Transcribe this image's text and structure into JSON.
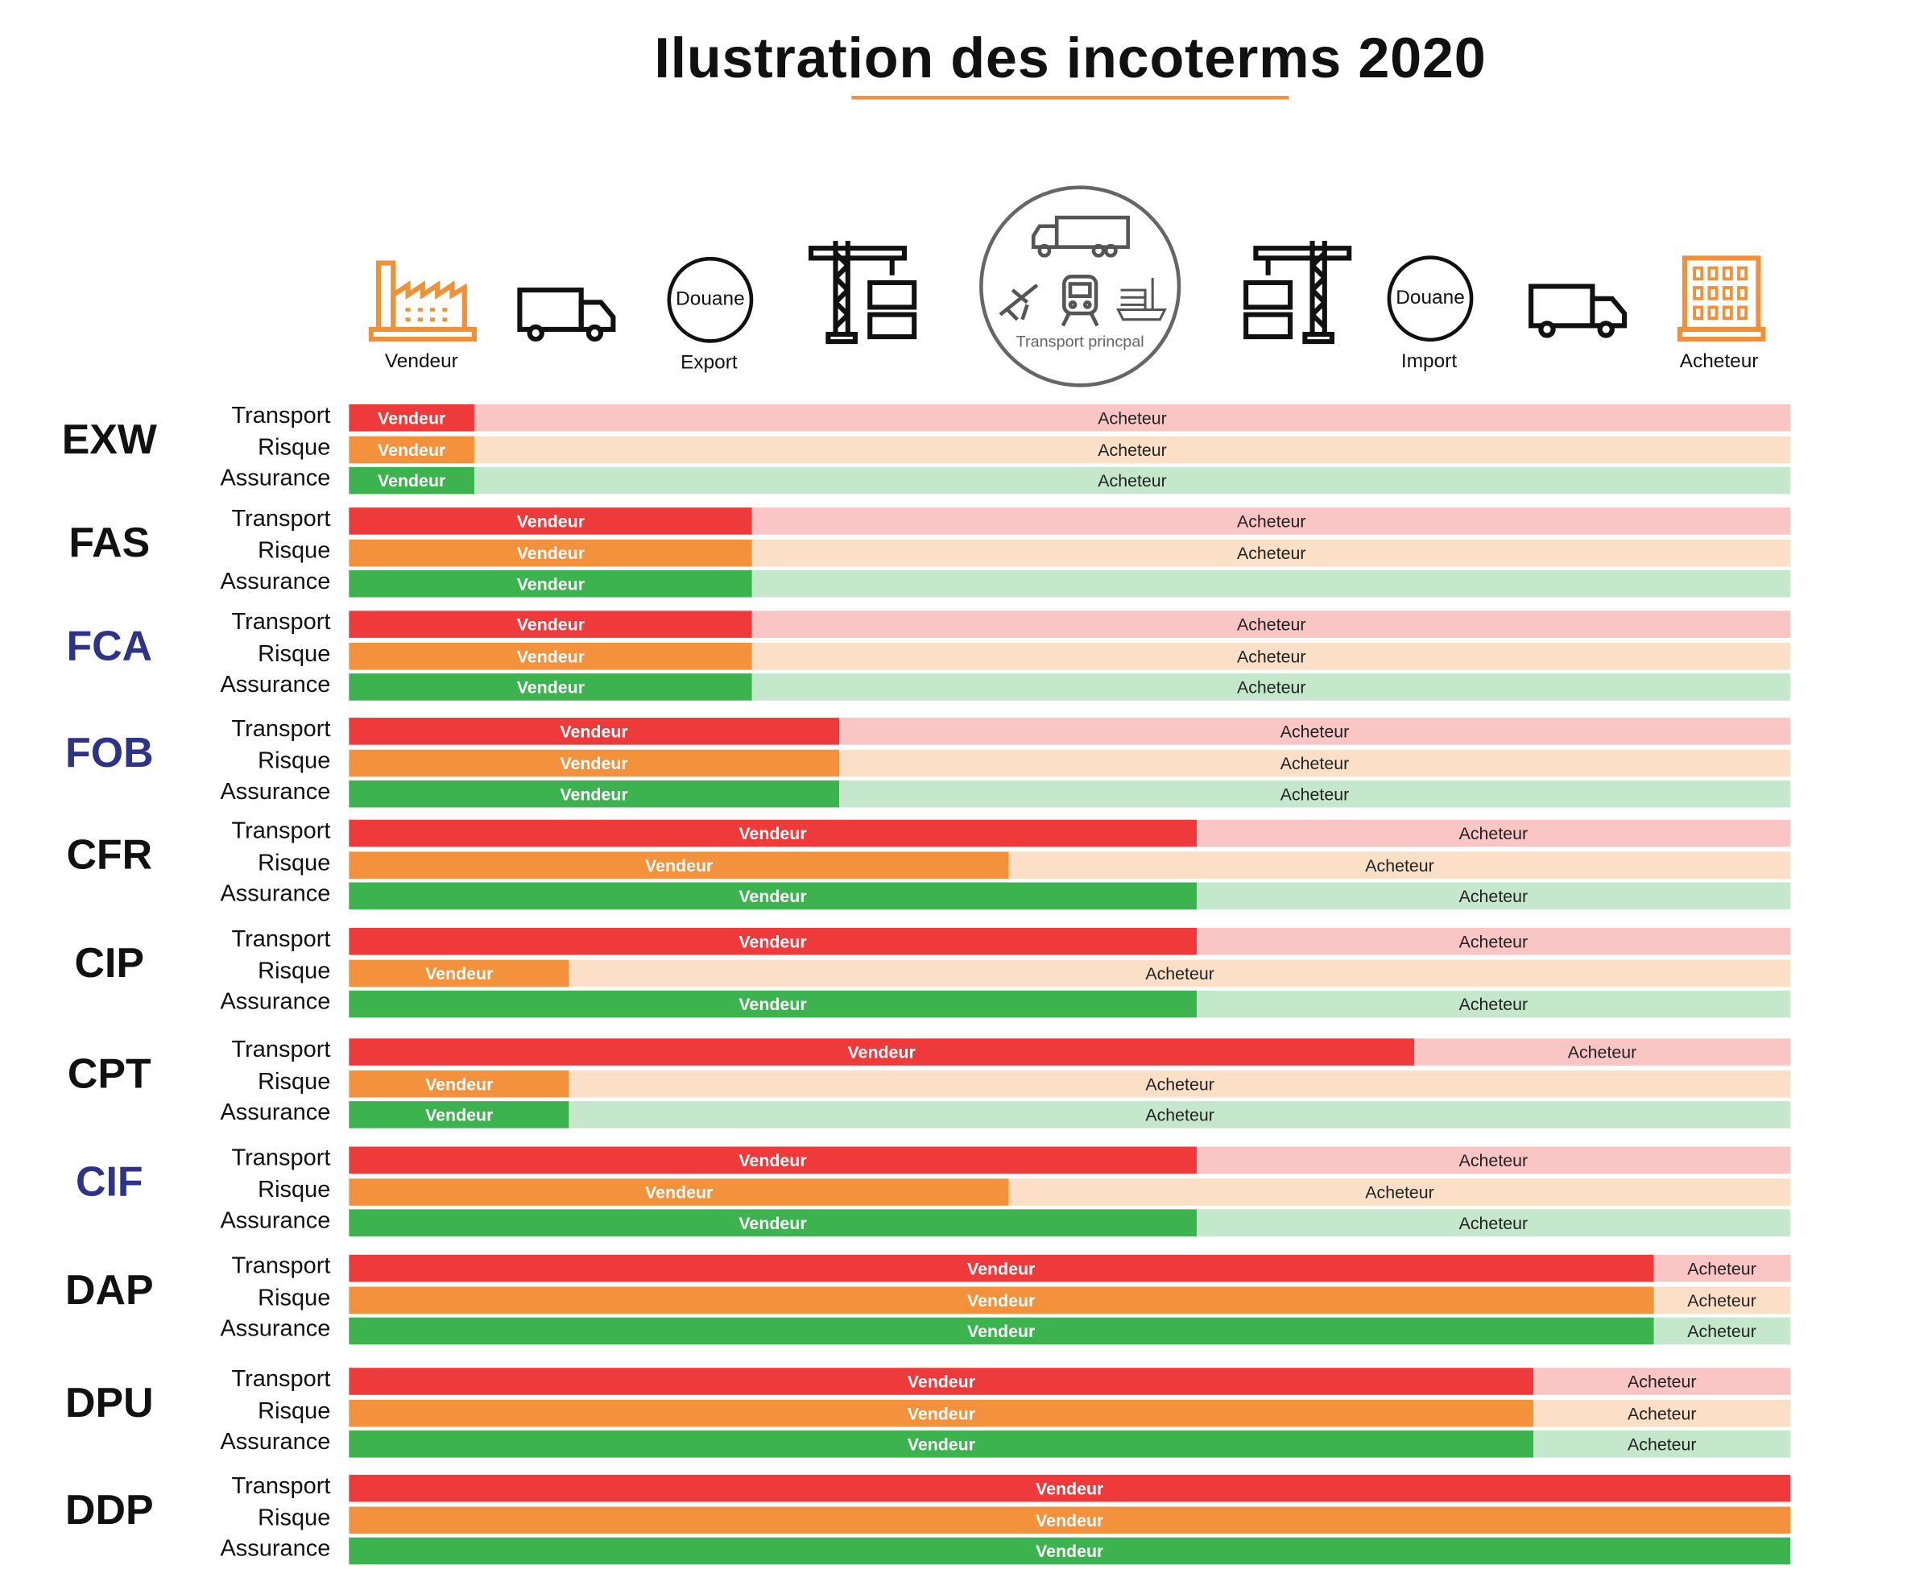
{
  "title": "Ilustration des incoterms 2020",
  "colors": {
    "accent": "#f0913a",
    "highlight_code": "#2e3388",
    "transport": {
      "seller": "#ee3a3b",
      "buyer": "#f9c5c5"
    },
    "risque": {
      "seller": "#f4913d",
      "buyer": "#fbdfc7"
    },
    "assurance": {
      "seller": "#3db34f",
      "buyer": "#c5e8cc"
    }
  },
  "chain": [
    {
      "icon": "factory-icon",
      "caption": "Vendeur"
    },
    {
      "icon": "truck-icon",
      "caption": ""
    },
    {
      "icon": "customs-icon",
      "text": "Douane",
      "caption": "Export"
    },
    {
      "icon": "crane-icon",
      "caption": ""
    },
    {
      "icon": "main-transport-icon",
      "caption": "Transport princpal"
    },
    {
      "icon": "crane-icon",
      "caption": ""
    },
    {
      "icon": "customs-icon",
      "text": "Douane",
      "caption": "Import"
    },
    {
      "icon": "truck-icon",
      "caption": ""
    },
    {
      "icon": "building-icon",
      "caption": "Acheteur"
    }
  ],
  "seller_label": "Vendeur",
  "buyer_label": "Acheteur",
  "row_labels": [
    "Transport",
    "Risque",
    "Assurance"
  ],
  "incoterms": [
    {
      "code": "EXW",
      "highlight": false,
      "seller_share_pct": [
        8.7,
        8.7,
        8.7
      ]
    },
    {
      "code": "FAS",
      "highlight": false,
      "seller_share_pct": [
        28,
        28,
        28
      ],
      "buyer_label_hidden": [
        false,
        false,
        true
      ]
    },
    {
      "code": "FCA",
      "highlight": true,
      "seller_share_pct": [
        28,
        28,
        28
      ]
    },
    {
      "code": "FOB",
      "highlight": true,
      "seller_share_pct": [
        34,
        34,
        34
      ]
    },
    {
      "code": "CFR",
      "highlight": false,
      "seller_share_pct": [
        58.8,
        45.8,
        58.8
      ]
    },
    {
      "code": "CIP",
      "highlight": false,
      "seller_share_pct": [
        58.8,
        15.3,
        58.8
      ]
    },
    {
      "code": "CPT",
      "highlight": false,
      "seller_share_pct": [
        73.9,
        15.3,
        15.3
      ]
    },
    {
      "code": "CIF",
      "highlight": true,
      "seller_share_pct": [
        58.8,
        45.8,
        58.8
      ]
    },
    {
      "code": "DAP",
      "highlight": false,
      "seller_share_pct": [
        90.5,
        90.5,
        90.5
      ]
    },
    {
      "code": "DPU",
      "highlight": false,
      "seller_share_pct": [
        82.2,
        82.2,
        82.2
      ]
    },
    {
      "code": "DDP",
      "highlight": false,
      "seller_share_pct": [
        100,
        100,
        100
      ]
    }
  ]
}
